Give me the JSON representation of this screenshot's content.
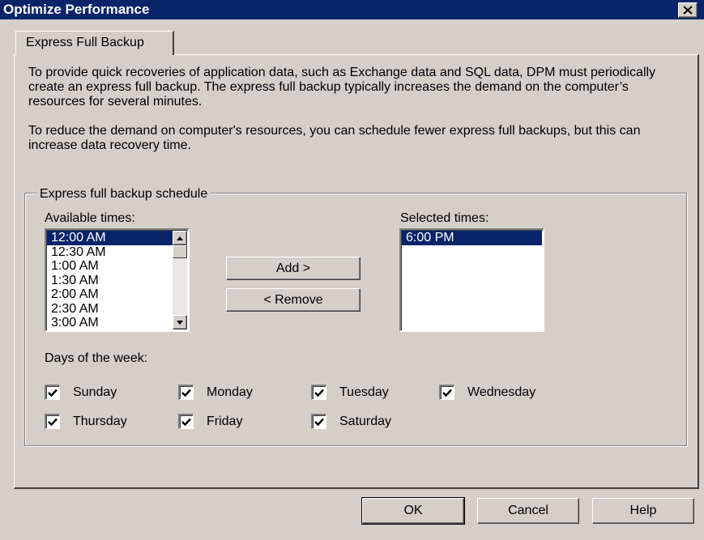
{
  "window": {
    "title": "Optimize Performance"
  },
  "tabs": [
    {
      "label": "Express Full Backup"
    }
  ],
  "description": {
    "p1": "To provide quick recoveries of application data, such as Exchange data and SQL data, DPM must periodically create an express full backup. The express full backup typically increases the demand on the computer’s resources for several minutes.",
    "p2": "To reduce the demand on computer's resources, you can schedule fewer express full backups, but this can increase data recovery time."
  },
  "schedule": {
    "group_label": "Express full backup schedule",
    "available_label": "Available times:",
    "available_times": [
      "12:00 AM",
      "12:30 AM",
      "1:00 AM",
      "1:30 AM",
      "2:00 AM",
      "2:30 AM",
      "3:00 AM"
    ],
    "available_selected": "12:00 AM",
    "selected_label": "Selected times:",
    "selected_times": [
      "6:00 PM"
    ],
    "add_label": "Add >",
    "remove_label": "< Remove",
    "days_label": "Days of the week:",
    "days": [
      {
        "label": "Sunday",
        "checked": true
      },
      {
        "label": "Monday",
        "checked": true
      },
      {
        "label": "Tuesday",
        "checked": true
      },
      {
        "label": "Wednesday",
        "checked": true
      },
      {
        "label": "Thursday",
        "checked": true
      },
      {
        "label": "Friday",
        "checked": true
      },
      {
        "label": "Saturday",
        "checked": true
      }
    ]
  },
  "footer": {
    "ok_label": "OK",
    "cancel_label": "Cancel",
    "help_label": "Help"
  },
  "icons": {
    "close": "close-icon",
    "scroll_up": "scroll-up-arrow-icon",
    "scroll_down": "scroll-down-arrow-icon",
    "check": "checkmark-icon"
  },
  "colors": {
    "title_bar": "#0a246a",
    "selection": "#0a246a",
    "dialog_face": "#d4d0c8"
  }
}
